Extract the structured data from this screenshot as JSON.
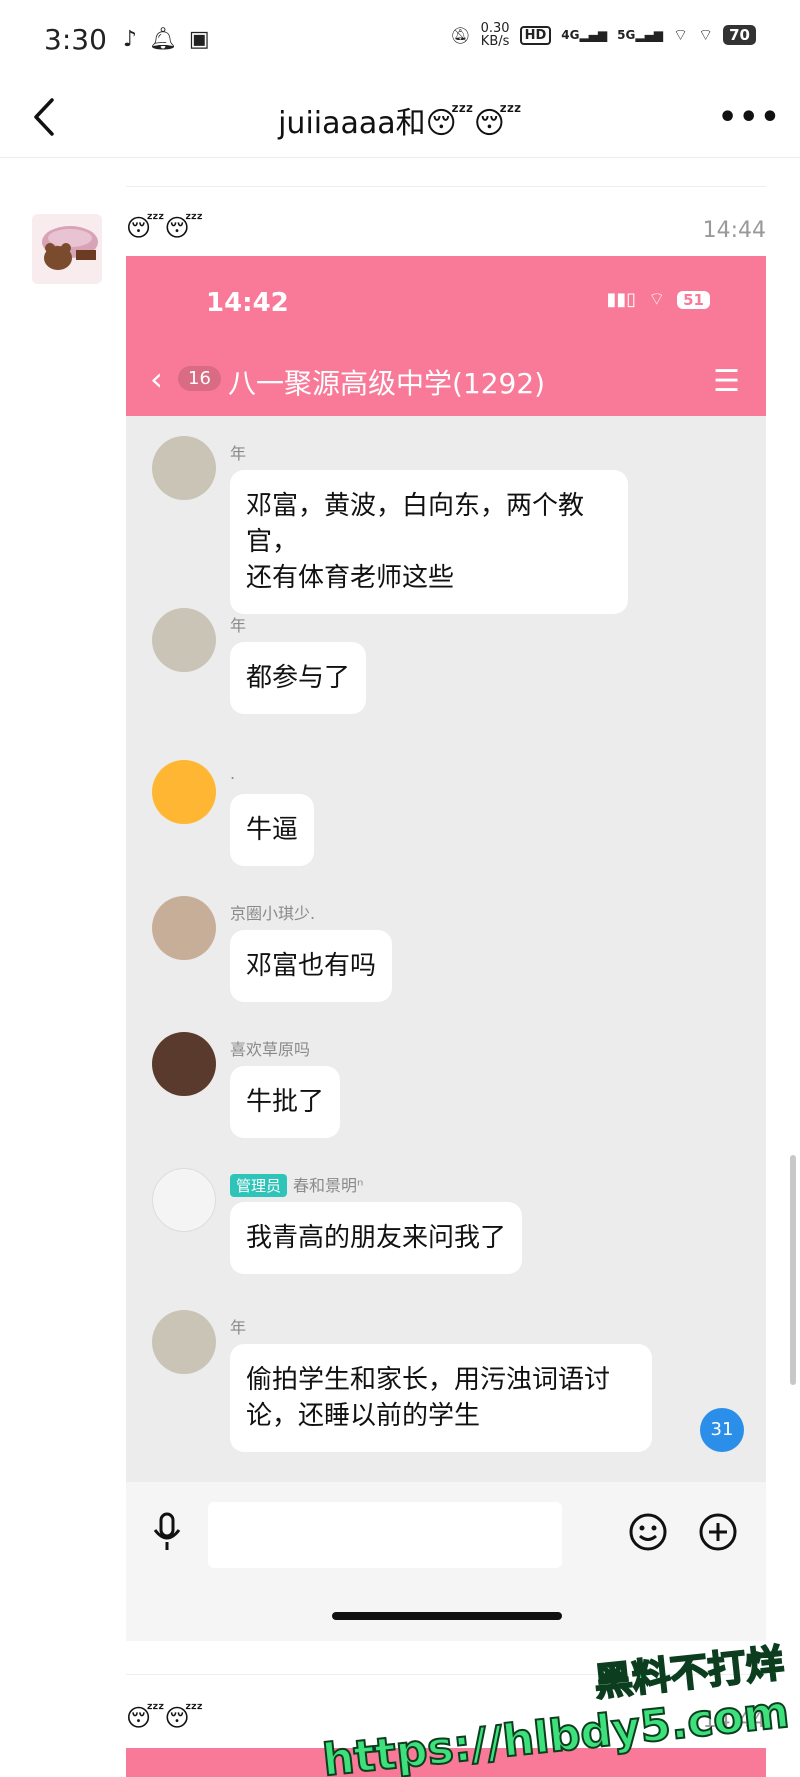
{
  "status_bar": {
    "time": "3:30",
    "net_speed_value": "0.30",
    "net_speed_unit": "KB/s",
    "hd_label": "HD",
    "sig1_label": "4G",
    "sig2_label": "5G",
    "battery": "70"
  },
  "header": {
    "title": "juiiaaaa和😴😴"
  },
  "messages": [
    {
      "emoji": "😴😴",
      "time": "14:44",
      "screenshot": {
        "status_time": "14:42",
        "battery": "51",
        "unread_count": "16",
        "group_title": "八一聚源高级中学(1292)",
        "chat": [
          {
            "name": "年",
            "text_lines": [
              "邓富，黄波，白向东，两个教官，",
              "还有体育老师这些"
            ]
          },
          {
            "name": "年",
            "text_lines": [
              "都参与了"
            ]
          },
          {
            "name": ".",
            "text_lines": [
              "牛逼"
            ]
          },
          {
            "name": "京圈小琪少.",
            "text_lines": [
              "邓富也有吗"
            ]
          },
          {
            "name": "喜欢草原吗",
            "text_lines": [
              "牛批了"
            ]
          },
          {
            "role_tag": "管理员",
            "name": "春和景明ⁿ",
            "text_lines": [
              "我青高的朋友来问我了"
            ]
          },
          {
            "name": "年",
            "text_lines": [
              "偷拍学生和家长，用污浊词语讨",
              "论，还睡以前的学生"
            ]
          }
        ],
        "new_message_badge": "31"
      }
    },
    {
      "emoji": "😴😴",
      "time": "14:44"
    }
  ],
  "watermark": {
    "line1": "黑料不打烊",
    "line2": "https://hlbdy5.com"
  },
  "colors": {
    "screenshot_header": "#f87a98",
    "admin_tag": "#2fc4b8",
    "badge": "#2b8ee8",
    "watermark": "#3de07a"
  }
}
